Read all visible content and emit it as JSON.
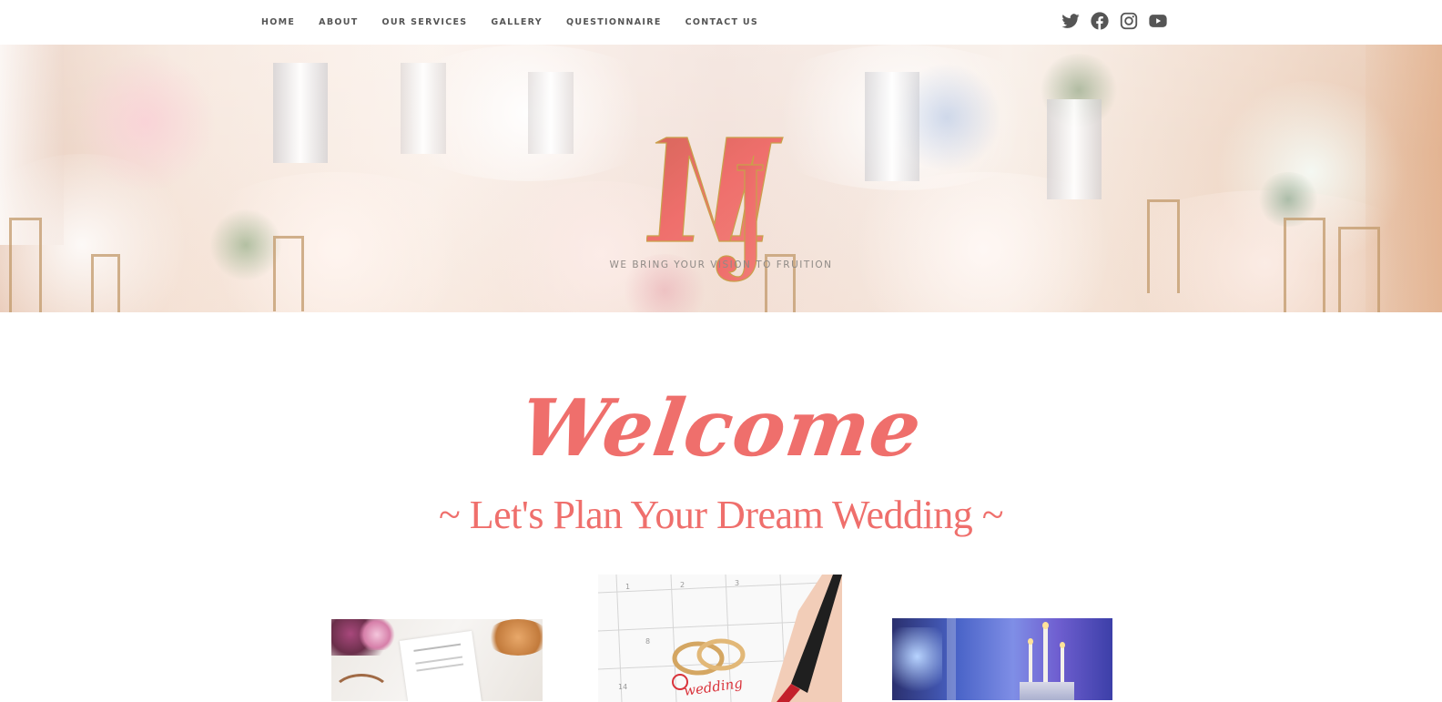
{
  "nav": {
    "items": [
      {
        "label": "HOME"
      },
      {
        "label": "ABOUT"
      },
      {
        "label": "OUR SERVICES"
      },
      {
        "label": "GALLERY"
      },
      {
        "label": "QUESTIONNAIRE"
      },
      {
        "label": "CONTACT US"
      }
    ],
    "social": [
      "twitter-icon",
      "facebook-icon",
      "instagram-icon",
      "youtube-icon"
    ],
    "color": "#555555"
  },
  "hero": {
    "logo_text": "MJ",
    "tagline": "WE BRING YOUR VISION TO FRUITION"
  },
  "main": {
    "welcome": "Welcome",
    "subtitle": "~ Let's Plan Your Dream Wedding ~",
    "accent": "#ef6f6c"
  },
  "photos": [
    {
      "name": "planner-notebook-photo"
    },
    {
      "name": "calendar-rings-photo",
      "text": "wedding"
    },
    {
      "name": "reception-candles-photo"
    }
  ]
}
